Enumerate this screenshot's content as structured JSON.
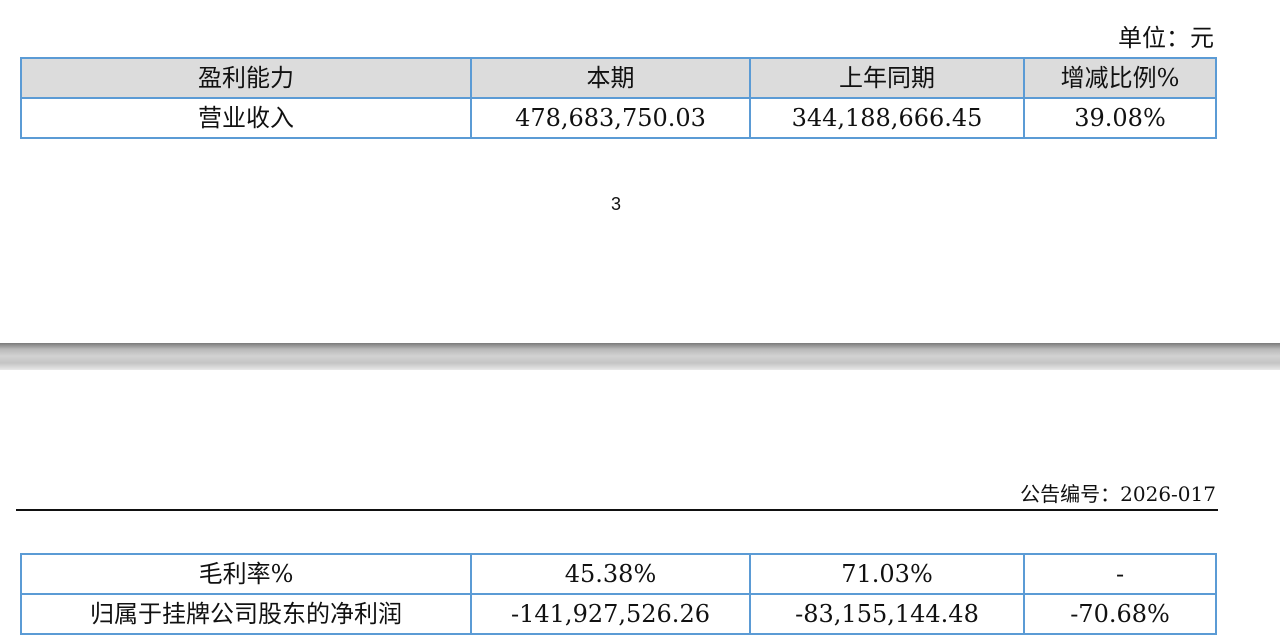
{
  "page_top": {
    "unit_label": "单位：元",
    "table": {
      "headers": [
        "盈利能力",
        "本期",
        "上年同期",
        "增减比例%"
      ],
      "rows": [
        [
          "营业收入",
          "478,683,750.03",
          "344,188,666.45",
          "39.08%"
        ]
      ]
    },
    "page_number": "3"
  },
  "page_bottom": {
    "notice_number": "公告编号：2026-017",
    "table": {
      "rows": [
        [
          "毛利率%",
          "45.38%",
          "71.03%",
          "-"
        ],
        [
          "归属于挂牌公司股东的净利润",
          "-141,927,526.26",
          "-83,155,144.48",
          "-70.68%"
        ]
      ]
    }
  },
  "colors": {
    "table_border": "#5b9bd5",
    "header_fill": "#dcdcdc",
    "page_gap": "#c4c4c4"
  }
}
